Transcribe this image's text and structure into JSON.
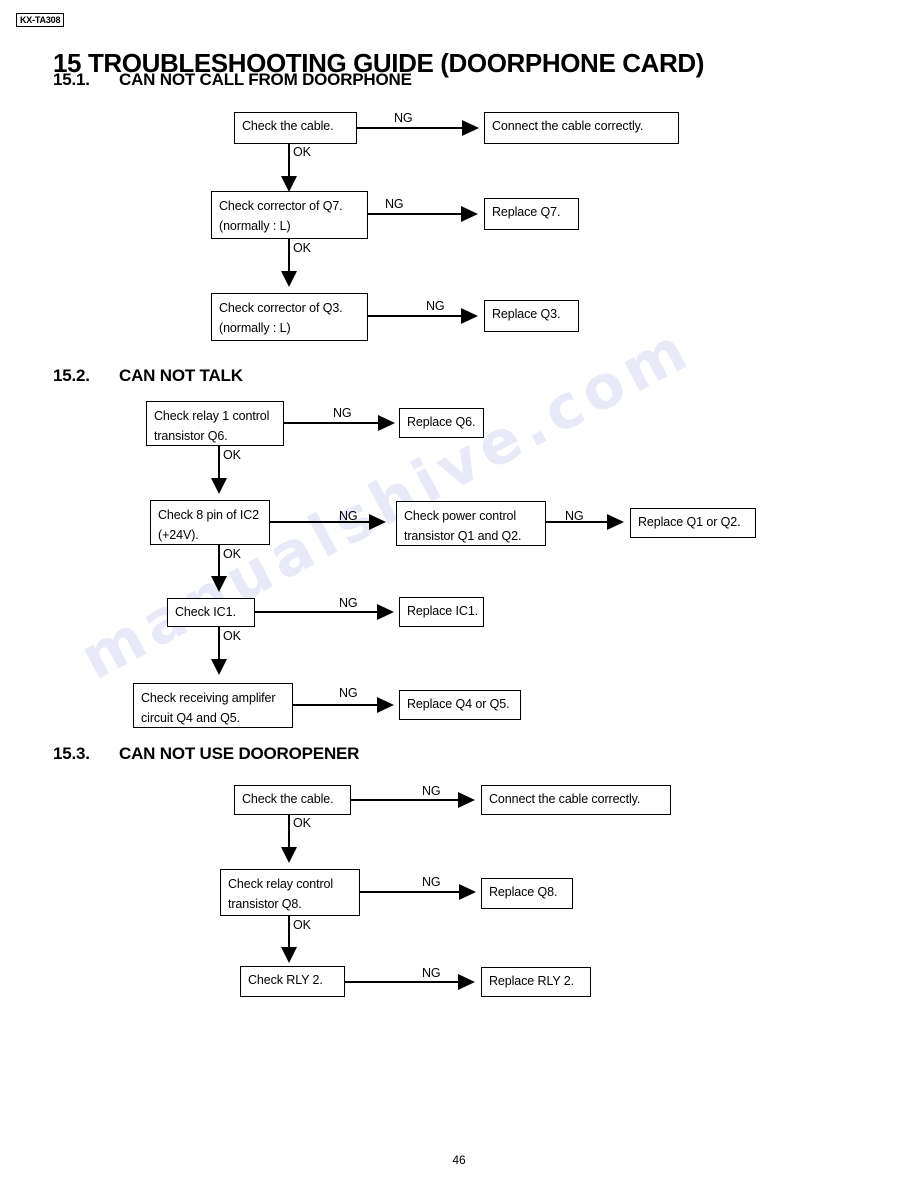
{
  "document": {
    "model_badge": "KX-TA308",
    "title": "15 TROUBLESHOOTING GUIDE (DOORPHONE CARD)",
    "page_number": "46",
    "watermark": "manualshive.com"
  },
  "labels": {
    "ok": "OK",
    "ng": "NG"
  },
  "sections": [
    {
      "number": "15.1.",
      "title": "CAN NOT CALL FROM DOORPHONE",
      "nodes": {
        "check_cable": "Check the cable.",
        "connect_cable": "Connect the cable correctly.",
        "check_q7_l1": "Check corrector of Q7.",
        "check_q7_l2": "(normally : L)",
        "replace_q7": "Replace Q7.",
        "check_q3_l1": "Check corrector of Q3.",
        "check_q3_l2": "(normally : L)",
        "replace_q3": "Replace Q3."
      }
    },
    {
      "number": "15.2.",
      "title": "CAN NOT TALK",
      "nodes": {
        "check_relay1_l1": "Check relay 1 control",
        "check_relay1_l2": "transistor Q6.",
        "replace_q6": "Replace Q6.",
        "check_ic2_l1": "Check 8 pin of IC2",
        "check_ic2_l2": "(+24V).",
        "check_power_l1": "Check power control",
        "check_power_l2": "transistor Q1 and Q2.",
        "replace_q1_q2": "Replace Q1 or Q2.",
        "check_ic1": "Check IC1.",
        "replace_ic1": "Replace IC1.",
        "check_amp_l1": "Check receiving amplifer",
        "check_amp_l2": "circuit Q4 and Q5.",
        "replace_q4_q5": "Replace Q4 or Q5."
      }
    },
    {
      "number": "15.3.",
      "title": "CAN NOT USE DOOROPENER",
      "nodes": {
        "check_cable": "Check the cable.",
        "connect_cable": "Connect the cable correctly.",
        "check_relay_l1": "Check relay control",
        "check_relay_l2": "transistor Q8.",
        "replace_q8": "Replace Q8.",
        "check_rly2": "Check RLY 2.",
        "replace_rly2": "Replace RLY 2."
      }
    }
  ]
}
